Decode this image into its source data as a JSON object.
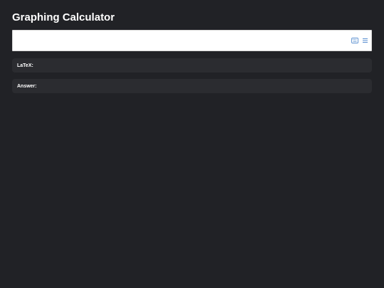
{
  "header": {
    "title": "Graphing Calculator"
  },
  "math_field": {
    "value": "",
    "icons": [
      "keyboard-icon",
      "menu-icon"
    ],
    "accent_color": "#5a8fd0"
  },
  "latex_panel": {
    "label": "LaTeX:",
    "value": ""
  },
  "answer_panel": {
    "label": "Answer:",
    "value": ""
  }
}
